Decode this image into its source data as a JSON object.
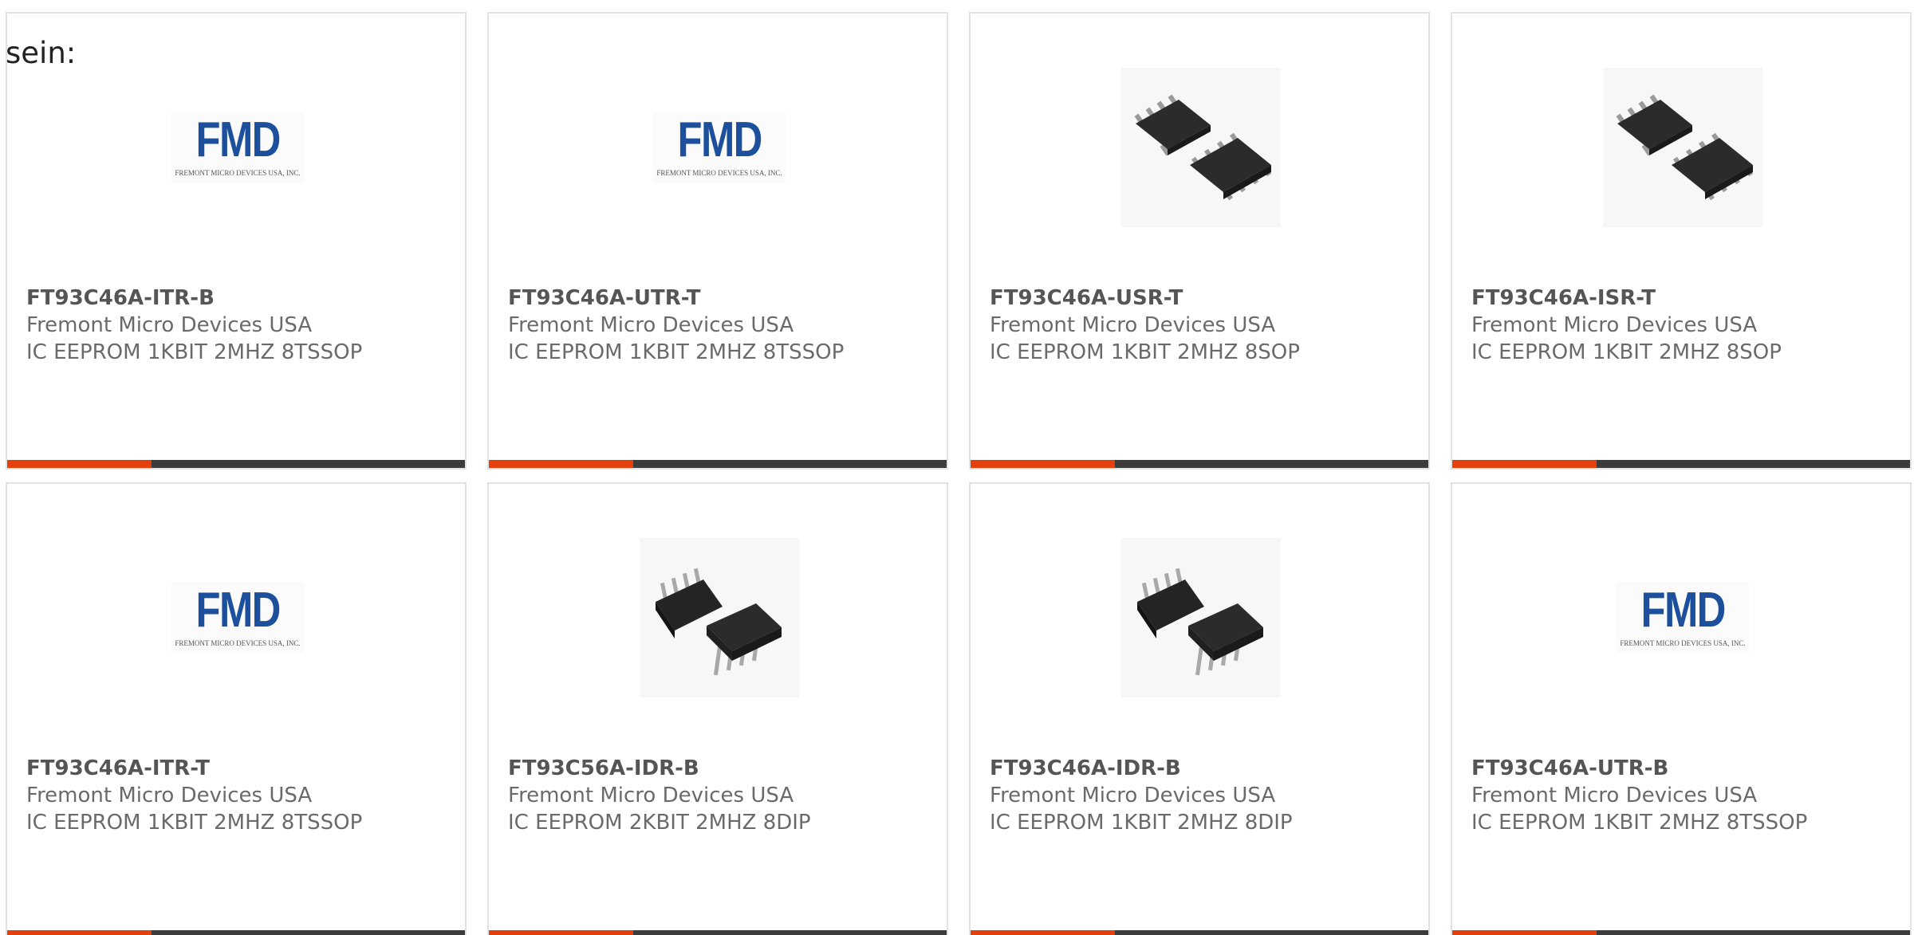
{
  "intro_text": "sein:",
  "colors": {
    "accent": "#e3400e",
    "bar": "#3c3c3c",
    "logo_blue": "#1c4f9c",
    "border": "#e2e2e2"
  },
  "products": [
    {
      "part_number": "FT93C46A-ITR-B",
      "manufacturer": "Fremont Micro Devices USA",
      "description": "IC EEPROM 1KBIT 2MHZ 8TSSOP",
      "image": "fmd-logo",
      "logo_text": "FMD",
      "logo_subtext": "FREMONT MICRO DEVICES USA, INC."
    },
    {
      "part_number": "FT93C46A-UTR-T",
      "manufacturer": "Fremont Micro Devices USA",
      "description": "IC EEPROM 1KBIT 2MHZ 8TSSOP",
      "image": "fmd-logo",
      "logo_text": "FMD",
      "logo_subtext": "FREMONT MICRO DEVICES USA, INC."
    },
    {
      "part_number": "FT93C46A-USR-T",
      "manufacturer": "Fremont Micro Devices USA",
      "description": "IC EEPROM 1KBIT 2MHZ 8SOP",
      "image": "soic-8-chip-photo"
    },
    {
      "part_number": "FT93C46A-ISR-T",
      "manufacturer": "Fremont Micro Devices USA",
      "description": "IC EEPROM 1KBIT 2MHZ 8SOP",
      "image": "soic-8-chip-photo"
    },
    {
      "part_number": "FT93C46A-ITR-T",
      "manufacturer": "Fremont Micro Devices USA",
      "description": "IC EEPROM 1KBIT 2MHZ 8TSSOP",
      "image": "fmd-logo",
      "logo_text": "FMD",
      "logo_subtext": "FREMONT MICRO DEVICES USA, INC."
    },
    {
      "part_number": "FT93C56A-IDR-B",
      "manufacturer": "Fremont Micro Devices USA",
      "description": "IC EEPROM 2KBIT 2MHZ 8DIP",
      "image": "dip-8-chip-photo"
    },
    {
      "part_number": "FT93C46A-IDR-B",
      "manufacturer": "Fremont Micro Devices USA",
      "description": "IC EEPROM 1KBIT 2MHZ 8DIP",
      "image": "dip-8-chip-photo"
    },
    {
      "part_number": "FT93C46A-UTR-B",
      "manufacturer": "Fremont Micro Devices USA",
      "description": "IC EEPROM 1KBIT 2MHZ 8TSSOP",
      "image": "fmd-logo",
      "logo_text": "FMD",
      "logo_subtext": "FREMONT MICRO DEVICES USA, INC."
    }
  ]
}
